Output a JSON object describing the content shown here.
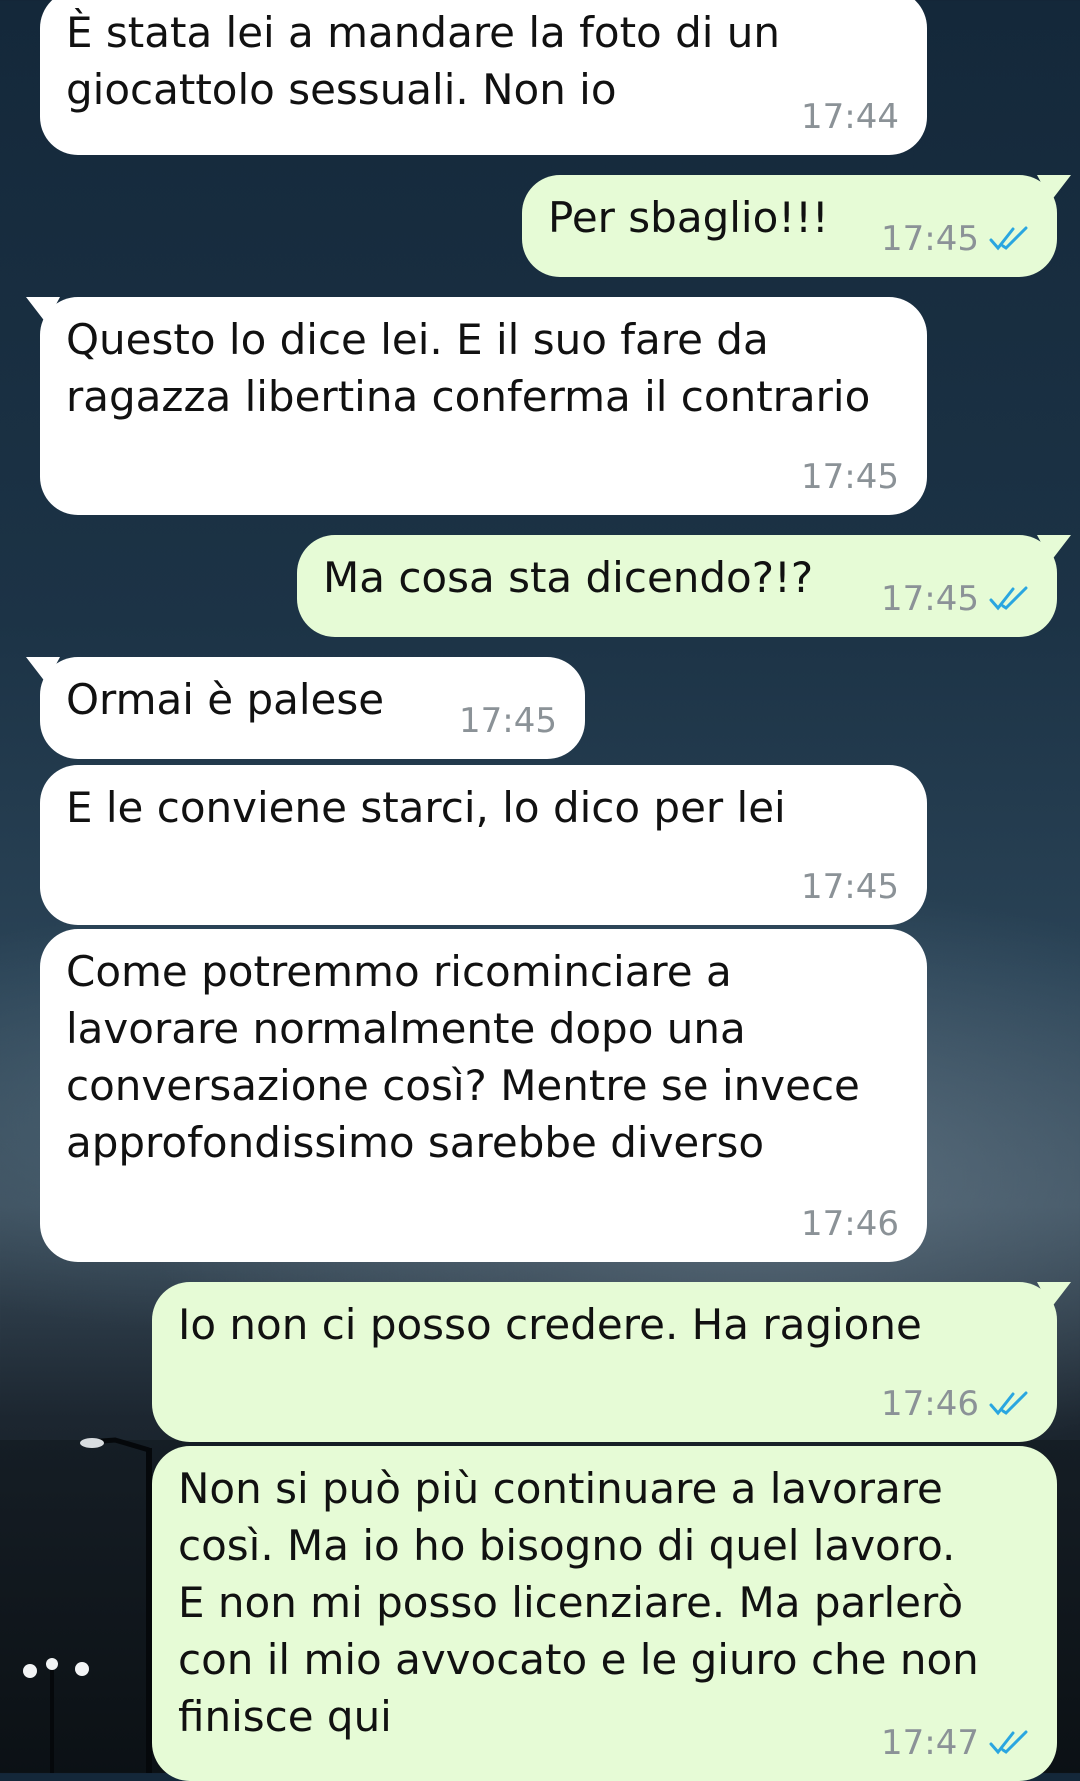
{
  "colors": {
    "incoming_bubble": "#ffffff",
    "outgoing_bubble": "#e6fbd6",
    "time_text": "#8b9297",
    "read_ticks": "#2aa6e0"
  },
  "messages": [
    {
      "direction": "incoming",
      "text": "È stata lei a mandare la foto di un\ngiocattolo sessuali. Non io",
      "time": "17:44"
    },
    {
      "direction": "outgoing",
      "text": "Per sbaglio!!!",
      "time": "17:45",
      "status_icon": "read-double-check-icon"
    },
    {
      "direction": "incoming",
      "text": "Questo lo dice lei. E il suo fare da\nragazza libertina conferma il contrario",
      "time": "17:45"
    },
    {
      "direction": "outgoing",
      "text": "Ma cosa sta dicendo?!?",
      "time": "17:45",
      "status_icon": "read-double-check-icon"
    },
    {
      "direction": "incoming",
      "text": "Ormai è palese",
      "time": "17:45"
    },
    {
      "direction": "incoming",
      "text": "E le conviene starci, lo dico per lei",
      "time": "17:45"
    },
    {
      "direction": "incoming",
      "text": "Come potremmo ricominciare a\nlavorare normalmente dopo una\nconversazione così? Mentre se invece\napprofondissimo sarebbe diverso",
      "time": "17:46"
    },
    {
      "direction": "outgoing",
      "text": "Io non ci posso credere. Ha ragione",
      "time": "17:46",
      "status_icon": "read-double-check-icon"
    },
    {
      "direction": "outgoing",
      "text": "Non si può più continuare a lavorare\ncosì. Ma io ho bisogno di quel lavoro.\nE non mi posso licenziare. Ma parlerò\ncon il mio avvocato e le giuro che non\nfinisce qui",
      "time": "17:47",
      "status_icon": "read-double-check-icon"
    }
  ]
}
